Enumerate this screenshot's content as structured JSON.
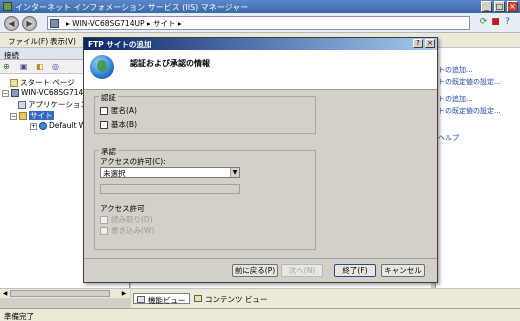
{
  "window": {
    "title": "インターネット インフォメーション サービス (IIS) マネージャー"
  },
  "address": {
    "path": [
      "WIN-VC68SG714UP",
      "サイト"
    ]
  },
  "menu": {
    "items": [
      "ファイル(F)",
      "表示(V)"
    ]
  },
  "connections": {
    "header": "接続",
    "tree": [
      {
        "label": "スタート ページ"
      },
      {
        "label": "WIN-VC68SG714"
      },
      {
        "label": "アプリケーション"
      },
      {
        "label": "サイト"
      },
      {
        "label": "Default W"
      }
    ]
  },
  "actions": {
    "links": [
      "トの追加...",
      "トの既定値の設定...",
      "トの追加...",
      "トの既定値の設定...",
      "ヘルプ"
    ]
  },
  "view_tabs": [
    "機能ビュー",
    "コンテンツ ビュー"
  ],
  "status": {
    "text": "準備完了"
  },
  "dialog": {
    "title": "FTP サイトの追加",
    "heading": "認証および承認の情報",
    "auth": {
      "legend": "認証",
      "options": [
        "匿名(A)",
        "基本(B)"
      ]
    },
    "authz": {
      "legend": "承認",
      "access_label": "アクセスの許可(C):",
      "access_value": "未選択",
      "permissions_label": "アクセス許可",
      "permissions": [
        "読み取り(D)",
        "書き込み(W)"
      ]
    },
    "buttons": {
      "prev": "前に戻る(P)",
      "next": "次へ(N)",
      "finish": "終了(F)",
      "cancel": "キャンセル"
    }
  }
}
